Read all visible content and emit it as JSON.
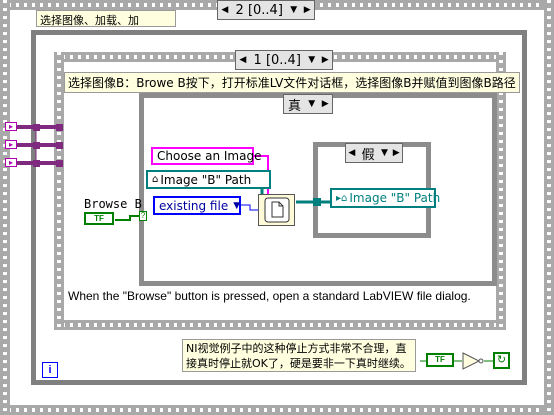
{
  "outer_frame": {
    "selector_label": "2 [0..4]",
    "subdiagram_label": "选择图像、加载、加"
  },
  "inner_frame": {
    "selector_label": "1 [0..4]",
    "description": "选择图像B：Browe B按下，打开标准LV文件对话框，选择图像B并赋值到图像B路径"
  },
  "case_true": {
    "label": "真"
  },
  "case_false": {
    "label": "假"
  },
  "nodes": {
    "choose_image": "Choose an Image",
    "image_b_path_ref": "Image \"B\" Path",
    "existing_file": "existing file",
    "image_b_path_local": "Image \"B\" Path",
    "browse_b_label": "Browse B",
    "browse_b_terminal": "TF",
    "stop_terminal": "TF"
  },
  "comments": {
    "browse_note": "When the \"Browse\" button is pressed, open a standard LabVIEW file dialog.",
    "stop_note_line1": "NI视觉例子中的这种停止方式非常不合理，直",
    "stop_note_line2": "接真时停止就OK了，硬是要非一下真时继续。"
  },
  "info_icon_label": "i",
  "colors": {
    "path_wire": "#007f7f",
    "string_wire": "#ff00ff",
    "enum_wire": "#0000ff",
    "bool_wire": "#007f00",
    "cluster_wire": "#7f2a7f"
  }
}
